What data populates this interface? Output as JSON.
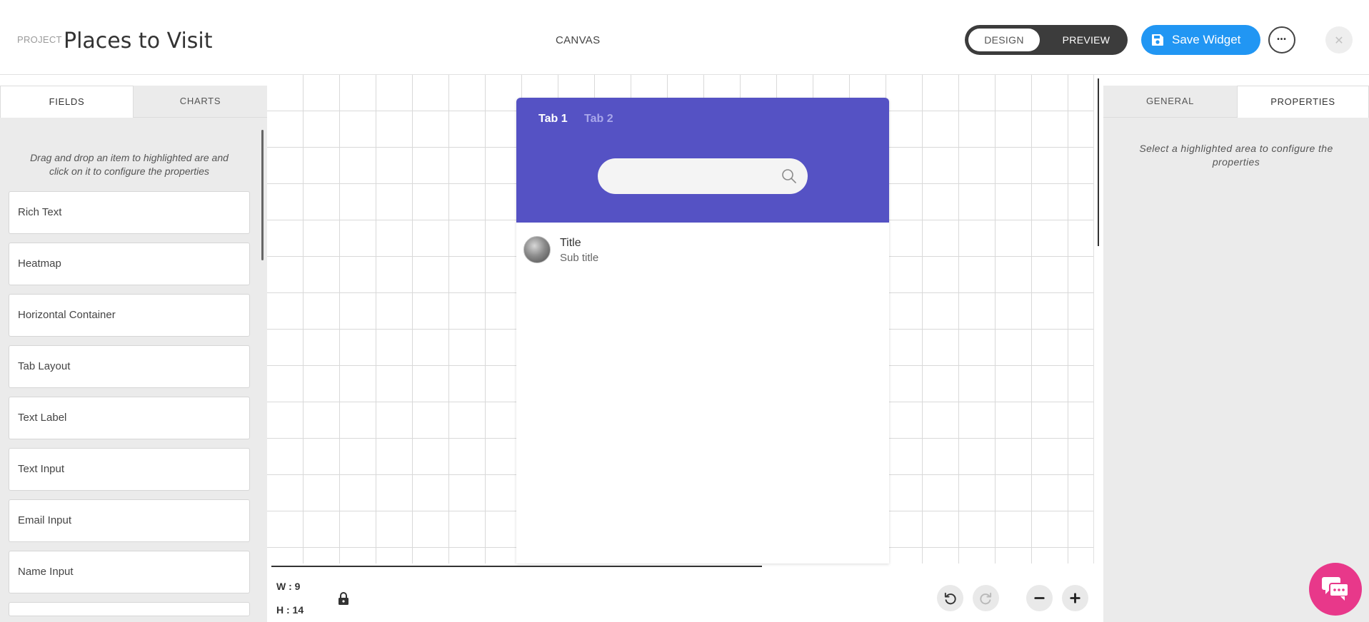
{
  "header": {
    "project_label": "PROJECT",
    "project_title": "Places to Visit",
    "canvas_label": "CANVAS",
    "mode_design": "DESIGN",
    "mode_preview": "PREVIEW",
    "active_mode": "DESIGN",
    "save_label": "Save Widget",
    "more_label": "•••",
    "close_label": "✕"
  },
  "left_panel": {
    "tabs": [
      {
        "label": "FIELDS",
        "active": true
      },
      {
        "label": "CHARTS",
        "active": false
      }
    ],
    "hint": "Drag and drop an item to highlighted are and click on it to configure the properties",
    "fields": [
      {
        "label": "Rich Text"
      },
      {
        "label": "Heatmap"
      },
      {
        "label": "Horizontal Container"
      },
      {
        "label": "Tab Layout"
      },
      {
        "label": "Text Label"
      },
      {
        "label": "Text Input"
      },
      {
        "label": "Email Input"
      },
      {
        "label": "Name Input"
      }
    ]
  },
  "widget": {
    "tabs": [
      {
        "label": "Tab 1",
        "active": true
      },
      {
        "label": "Tab 2",
        "active": false
      }
    ],
    "search_placeholder": "",
    "list_item": {
      "title": "Title",
      "subtitle": "Sub title"
    },
    "header_color": "#5552c4"
  },
  "bottom_bar": {
    "width_label": "W : 9",
    "height_label": "H : 14",
    "undo_icon": "undo-icon",
    "redo_icon": "redo-icon",
    "zoom_out_icon": "minus-icon",
    "zoom_in_icon": "plus-icon"
  },
  "right_panel": {
    "tabs": [
      {
        "label": "GENERAL",
        "active": false
      },
      {
        "label": "PROPERTIES",
        "active": true
      }
    ],
    "hint": "Select a highlighted area to configure the properties"
  },
  "colors": {
    "accent": "#2196f3",
    "chat": "#e8388a",
    "toggle_bg": "#3c3c3c"
  }
}
